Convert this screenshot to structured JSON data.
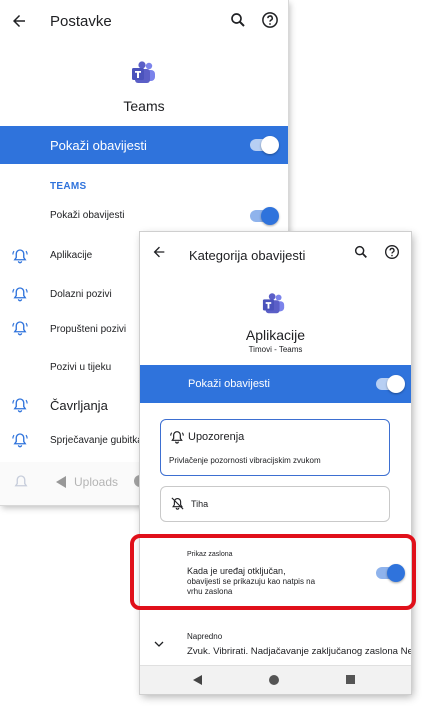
{
  "back": {
    "title": "Postavke",
    "app_name": "Teams",
    "master_toggle_label": "Pokaži obavijesti",
    "section_header": "TEAMS",
    "items": [
      {
        "label": "Pokaži obavijesti"
      },
      {
        "label": "Aplikacije"
      },
      {
        "label": "Dolazni pozivi"
      },
      {
        "label": "Propušteni pozivi"
      },
      {
        "label": "Pozivi u tijeku"
      },
      {
        "label": "Čavrljanja"
      },
      {
        "label": "Sprječavanje gubitka podataka"
      }
    ],
    "bottom_hint": "Uploads"
  },
  "front": {
    "title": "Kategorija obavijesti",
    "app_name": "Aplikacije",
    "app_subtitle": "Timovi - Teams",
    "master_toggle_label": "Pokaži obavijesti",
    "alerting": {
      "label": "Upozorenja",
      "description": "Privlačenje pozornosti vibracijskim zvukom"
    },
    "silent": {
      "label": "Tiha"
    },
    "lockscreen": {
      "title": "Prikaz zaslona",
      "line1": "Kada je uređaj otključan,",
      "line2": "obavijesti se prikazuju kao natpis na",
      "line3": "vrhu zaslona"
    },
    "advanced": {
      "title": "Napredno",
      "summary": "Zvuk. Vibrirati. Nadjačavanje zaključanog zaslona Ne ometaj"
    }
  },
  "colors": {
    "accent": "#2f73dc",
    "highlight": "#e0101a",
    "teams_purple": "#5b5fc7"
  }
}
